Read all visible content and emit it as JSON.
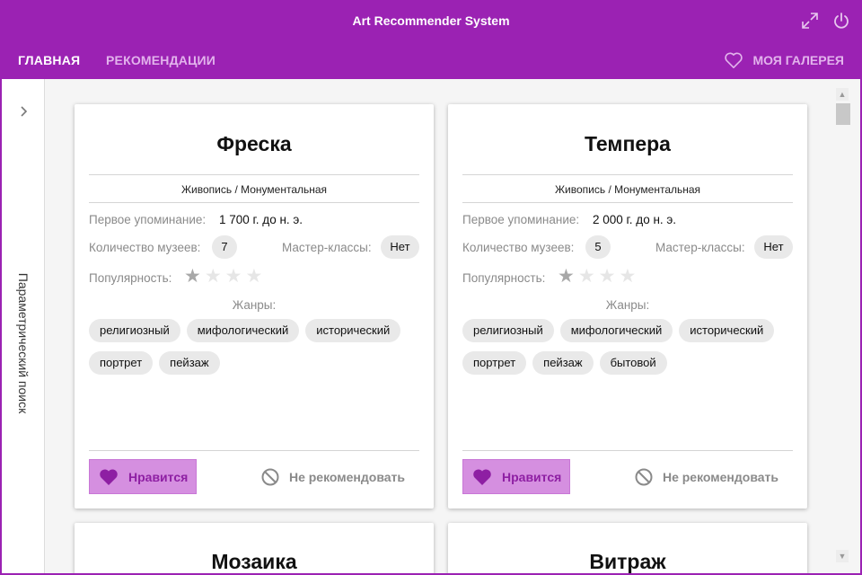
{
  "app": {
    "title": "Art Recommender System",
    "accent_color": "#9b22b3",
    "window_controls": [
      "expand-icon",
      "power-icon"
    ]
  },
  "nav": {
    "tabs": [
      {
        "label": "ГЛАВНАЯ",
        "active": true
      },
      {
        "label": "РЕКОМЕНДАЦИИ",
        "active": false
      }
    ],
    "gallery_label": "МОЯ ГАЛЕРЕЯ",
    "gallery_icon": "heart-outline-icon"
  },
  "sidebar": {
    "label": "Параметрический поиск",
    "expand_icon": "chevron-right-icon"
  },
  "labels": {
    "first_mention": "Первое упоминание:",
    "museums": "Количество музеев:",
    "masterclasses": "Мастер-классы:",
    "popularity": "Популярность:",
    "genres": "Жанры:",
    "like": "Нравится",
    "dislike": "Не рекомендовать"
  },
  "cards": [
    {
      "title": "Фреска",
      "category": "Живопись / Монументальная",
      "first_mention": "1 700 г. до н. э.",
      "museums": "7",
      "masterclasses": "Нет",
      "popularity": 1,
      "popularity_max": 4,
      "genres": [
        "религиозный",
        "мифологический",
        "исторический",
        "портрет",
        "пейзаж"
      ]
    },
    {
      "title": "Темпера",
      "category": "Живопись / Монументальная",
      "first_mention": "2 000 г. до н. э.",
      "museums": "5",
      "masterclasses": "Нет",
      "popularity": 1,
      "popularity_max": 4,
      "genres": [
        "религиозный",
        "мифологический",
        "исторический",
        "портрет",
        "пейзаж",
        "бытовой"
      ]
    },
    {
      "title": "Мозаика"
    },
    {
      "title": "Витраж"
    }
  ]
}
